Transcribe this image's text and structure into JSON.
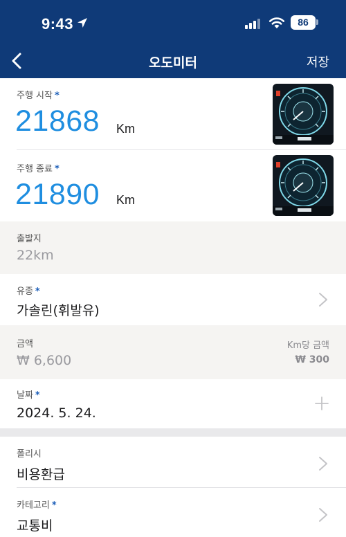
{
  "status_bar": {
    "time": "9:43",
    "battery": "86"
  },
  "nav": {
    "title": "오도미터",
    "save_label": "저장"
  },
  "odometer": {
    "start": {
      "label": "주행 시작",
      "value": "21868",
      "unit": "Km"
    },
    "end": {
      "label": "주행 종료",
      "value": "21890",
      "unit": "Km"
    }
  },
  "departure": {
    "label": "출발지",
    "value": "22km"
  },
  "fuel": {
    "label": "유종",
    "value": "가솔린(휘발유)"
  },
  "amount": {
    "label": "금액",
    "value": "₩ 6,600",
    "per_km_label": "Km당 금액",
    "per_km_value": "₩ 300"
  },
  "date": {
    "label": "날짜",
    "value": "2024. 5. 24."
  },
  "policy": {
    "label": "폴리시",
    "value": "비용환급"
  },
  "category": {
    "label": "카테고리",
    "value": "교통비"
  },
  "required_mark": "*",
  "colors": {
    "header": "#0f3a78",
    "accent": "#1f8ee0",
    "required": "#1a5db8"
  }
}
